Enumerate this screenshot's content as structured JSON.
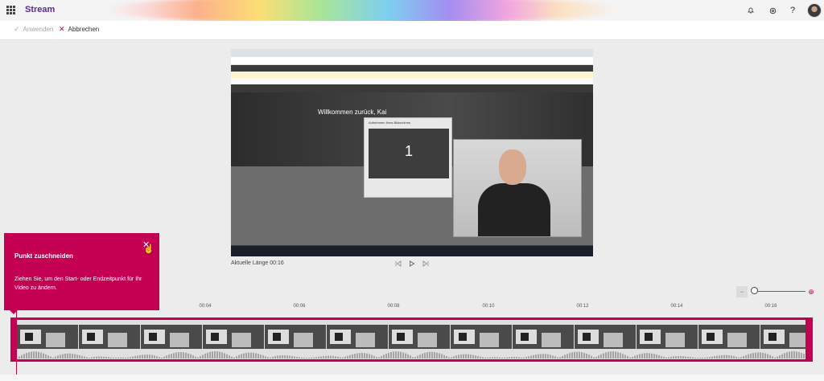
{
  "header": {
    "app_name": "Stream",
    "icons": [
      "waffle-icon",
      "bell-icon",
      "gear-icon",
      "help-icon",
      "avatar"
    ]
  },
  "toolbar": {
    "apply_label": "Anwenden",
    "cancel_label": "Abbrechen"
  },
  "video": {
    "welcome_text": "Willkommen zurück, Kai",
    "dialog_title": "Aufnehmen Ihres Bildschirms",
    "countdown": "1",
    "length_label": "Aktuelle Länge 00:16"
  },
  "tooltip": {
    "title": "Punkt zuschneiden",
    "text": "Ziehen Sie, um den Start- oder Endzeitpunkt für Ihr Video zu ändern."
  },
  "timeline": {
    "ticks": [
      "00:04",
      "00:06",
      "00:08",
      "00:10",
      "00:12",
      "00:14",
      "00:16"
    ]
  },
  "colors": {
    "accent": "#c30052",
    "brand": "#5b2d90"
  }
}
